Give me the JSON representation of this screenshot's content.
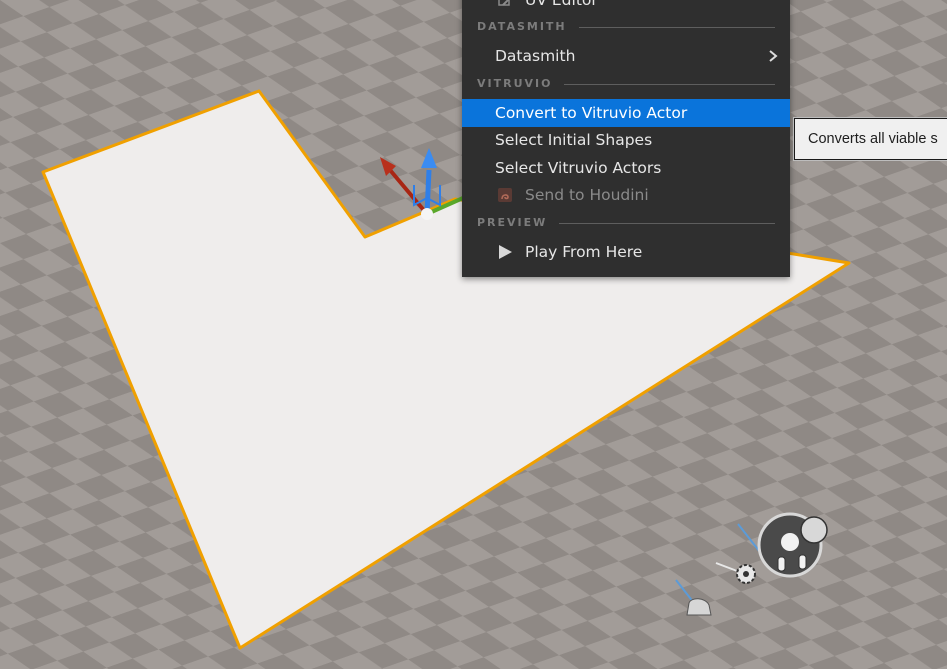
{
  "context_menu": {
    "items": {
      "uv_editor": {
        "label": "UV Editor",
        "icon": "uv-editor-icon"
      },
      "datasmith": {
        "label": "Datasmith",
        "icon": "chevron-right-icon"
      },
      "convert_to_vitruvio_actor": {
        "label": "Convert to Vitruvio Actor"
      },
      "select_initial_shapes": {
        "label": "Select Initial Shapes"
      },
      "select_vitruvio_actors": {
        "label": "Select Vitruvio Actors"
      },
      "send_to_houdini": {
        "label": "Send to Houdini",
        "icon": "houdini-icon"
      },
      "play_from_here": {
        "label": "Play From Here",
        "icon": "play-icon"
      }
    },
    "sections": {
      "datasmith": "DATASMITH",
      "vitruvio": "VITRUVIO",
      "preview": "PREVIEW"
    }
  },
  "tooltip": {
    "text": "Converts all viable s"
  },
  "colors": {
    "menu_background": "#2f2f2f",
    "highlight": "#0a74db",
    "selection_outline": "#f0a000",
    "floor_checker_light": "#a29c98",
    "floor_checker_dark": "#8f8985",
    "selected_shape_fill": "#efedec"
  }
}
